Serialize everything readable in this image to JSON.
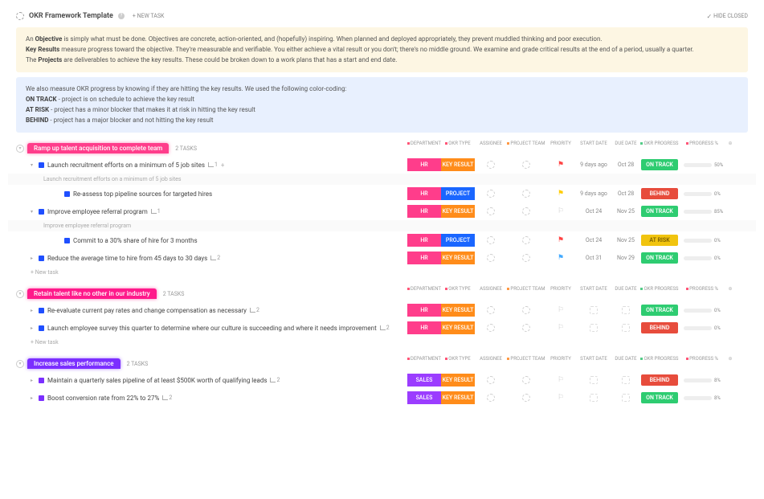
{
  "header": {
    "title": "OKR Framework Template",
    "new_task": "+ NEW TASK",
    "hide_closed": "HIDE CLOSED"
  },
  "description": {
    "line1_pre": "An ",
    "line1_bold": "Objective",
    "line1_post": " is simply what must be done. Objectives are concrete, action-oriented, and (hopefully) inspiring. When planned and deployed appropriately, they prevent muddled thinking and poor execution.",
    "line2_bold": "Key Results",
    "line2_post": " measure progress toward the objective. They're measurable and verifiable. You either achieve a vital result or you don't; there's no middle ground. We examine and grade critical results at the end of a period, usually a quarter.",
    "line3_pre": "The ",
    "line3_bold": "Projects",
    "line3_post": " are deliverables to achieve the key results. These could be broken down to a work plans that has a start and end date."
  },
  "legend": {
    "intro": "We also measure OKR progress by knowing if they are hitting the key results. We used the following color-coding:",
    "ontrack_b": "ON TRACK",
    "ontrack_t": " - project is on schedule to achieve the key result",
    "atrisk_b": "AT RISK",
    "atrisk_t": " - project has a minor blocker that makes it at risk in hitting the key result",
    "behind_b": "BEHIND",
    "behind_t": " - project has a major blocker and not hitting the key result"
  },
  "colheaders": {
    "dept": "DEPARTMENT",
    "okrtype": "OKR TYPE",
    "assignee": "ASSIGNEE",
    "team": "PROJECT TEAM",
    "priority": "PRIORITY",
    "start": "START DATE",
    "due": "DUE DATE",
    "progress": "OKR PROGRESS",
    "pct": "PROGRESS %"
  },
  "labels": {
    "keyresult": "KEY RESULT",
    "project": "PROJECT",
    "ontrack": "ON TRACK",
    "behind": "BEHIND",
    "atrisk": "AT RISK",
    "hr": "HR",
    "sales": "SALES",
    "newtask": "+ New task",
    "tasks_suffix": "TASKS"
  },
  "groups": [
    {
      "title": "Ramp up talent acquisition to complete team",
      "count": "2",
      "class": "group-pink",
      "rows": [
        {
          "indent": 0,
          "chevron": "▾",
          "dot": "dot-blue",
          "name": "Launch recruitment efforts on a minimum of 5 job sites",
          "sub": "1",
          "addsub": true,
          "dept": "HR",
          "okr": "keyresult",
          "prio": "red",
          "start": "9 days ago",
          "due": "Oct 28",
          "progress": "ontrack",
          "pct": 50
        },
        {
          "indent": 1,
          "header": true,
          "name": "Launch recruitment efforts on a minimum of 5 job sites"
        },
        {
          "indent": 2,
          "chevron": "",
          "dot": "dot-blue",
          "name": "Re-assess top pipeline sources for targeted hires",
          "dept": "HR",
          "okr": "project",
          "prio": "yellow",
          "start": "9 days ago",
          "due": "Oct 28",
          "progress": "behind",
          "pct": 0
        },
        {
          "indent": 0,
          "chevron": "▾",
          "dot": "dot-blue",
          "name": "Improve employee referral program",
          "sub": "1",
          "dept": "HR",
          "okr": "keyresult",
          "prio": "none",
          "start": "Oct 24",
          "due": "Nov 25",
          "progress": "ontrack",
          "pct": 85
        },
        {
          "indent": 1,
          "header": true,
          "name": "Improve employee referral program"
        },
        {
          "indent": 2,
          "chevron": "",
          "dot": "dot-blue",
          "name": "Commit to a 30% share of hire for 3 months",
          "dept": "HR",
          "okr": "project",
          "prio": "red",
          "start": "Oct 24",
          "due": "Nov 25",
          "progress": "atrisk",
          "pct": 0
        },
        {
          "indent": 0,
          "chevron": "▸",
          "dot": "dot-blue",
          "name": "Reduce the average time to hire from 45 days to 30 days",
          "sub": "2",
          "dept": "HR",
          "okr": "keyresult",
          "prio": "blue",
          "start": "Oct 31",
          "due": "Nov 29",
          "progress": "ontrack",
          "pct": 0
        }
      ],
      "newtask": true
    },
    {
      "title": "Retain talent like no other in our industry",
      "count": "2",
      "class": "group-pink2",
      "rows": [
        {
          "indent": 0,
          "chevron": "▸",
          "dot": "dot-blue",
          "name": "Re-evaluate current pay rates and change compensation as necessary",
          "sub": "2",
          "dept": "HR",
          "okr": "keyresult",
          "prio": "none",
          "startEmpty": true,
          "dueEmpty": true,
          "progress": "ontrack",
          "pct": 0
        },
        {
          "indent": 0,
          "chevron": "▸",
          "dot": "dot-blue",
          "name": "Launch employee survey this quarter to determine where our culture is succeeding and where it needs improvement",
          "sub": "2",
          "dept": "HR",
          "okr": "keyresult",
          "prio": "none",
          "startEmpty": true,
          "dueEmpty": true,
          "progress": "behind",
          "pct": 0
        }
      ],
      "newtask": true
    },
    {
      "title": "Increase sales performance",
      "count": "2",
      "class": "group-purple",
      "rows": [
        {
          "indent": 0,
          "chevron": "▸",
          "dot": "dot-purple",
          "name": "Maintain a quarterly sales pipeline of at least $500K worth of qualifying leads",
          "sub": "2",
          "dept": "SALES",
          "okr": "keyresult",
          "prio": "none",
          "startEmpty": true,
          "dueEmpty": true,
          "progress": "behind",
          "pct": 8
        },
        {
          "indent": 0,
          "chevron": "▸",
          "dot": "dot-purple",
          "name": "Boost conversion rate from 22% to 27%",
          "sub": "2",
          "dept": "SALES",
          "okr": "keyresult",
          "prio": "none",
          "startEmpty": true,
          "dueEmpty": true,
          "progress": "ontrack",
          "pct": 8
        }
      ]
    }
  ]
}
